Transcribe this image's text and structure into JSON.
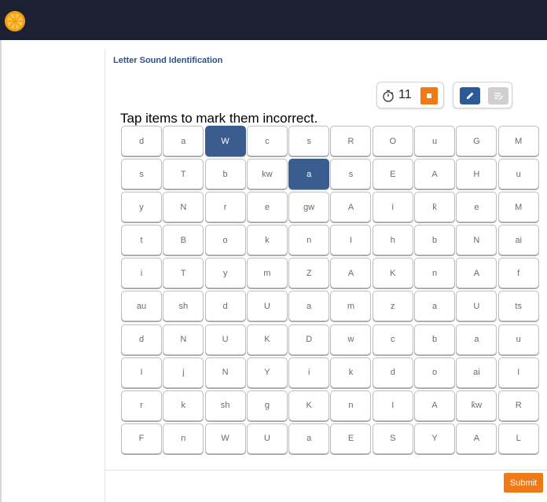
{
  "app": {
    "logo_icon": "orange-slice-icon",
    "header_color": "#1c2033",
    "accent_color": "#ef7a17",
    "selected_color": "#3a5c8e"
  },
  "task": {
    "title": "Letter Sound Identification",
    "instruction": "Tap items to mark them incorrect."
  },
  "timer": {
    "icon": "stopwatch-icon",
    "value": "11",
    "stop_icon": "stop-icon"
  },
  "mode": {
    "pen_icon": "pencil-icon",
    "pen_active": true,
    "note_icon": "notes-icon",
    "note_active": false
  },
  "grid": {
    "items": [
      [
        "d",
        "a",
        "W",
        "c",
        "s",
        "R",
        "O",
        "u",
        "G",
        "M"
      ],
      [
        "s",
        "T",
        "b",
        "kw",
        "a",
        "s",
        "E",
        "A",
        "H",
        "u"
      ],
      [
        "y",
        "N",
        "r",
        "e",
        "gw",
        "A",
        "i",
        "k̄",
        "e",
        "M"
      ],
      [
        "t",
        "B",
        "o",
        "k",
        "n",
        "I",
        "h",
        "b",
        "N",
        "ai"
      ],
      [
        "i",
        "T",
        "y",
        "m",
        "Z",
        "A",
        "K",
        "n",
        "A",
        "f"
      ],
      [
        "au",
        "sh",
        "d",
        "U",
        "a",
        "m",
        "z",
        "a",
        "U",
        "ts"
      ],
      [
        "d",
        "N",
        "U",
        "K",
        "D",
        "w",
        "c",
        "b",
        "a",
        "u"
      ],
      [
        "I",
        "j",
        "N",
        "Y",
        "i",
        "k",
        "d",
        "o",
        "ai",
        "I"
      ],
      [
        "r",
        "k",
        "sh",
        "g",
        "K",
        "n",
        "I",
        "A",
        "k̄w",
        "R"
      ],
      [
        "F",
        "n",
        "W",
        "U",
        "a",
        "E",
        "S",
        "Y",
        "A",
        "L"
      ]
    ],
    "selected": [
      [
        0,
        2
      ],
      [
        1,
        4
      ]
    ]
  },
  "footer": {
    "submit_label": "Submit"
  }
}
